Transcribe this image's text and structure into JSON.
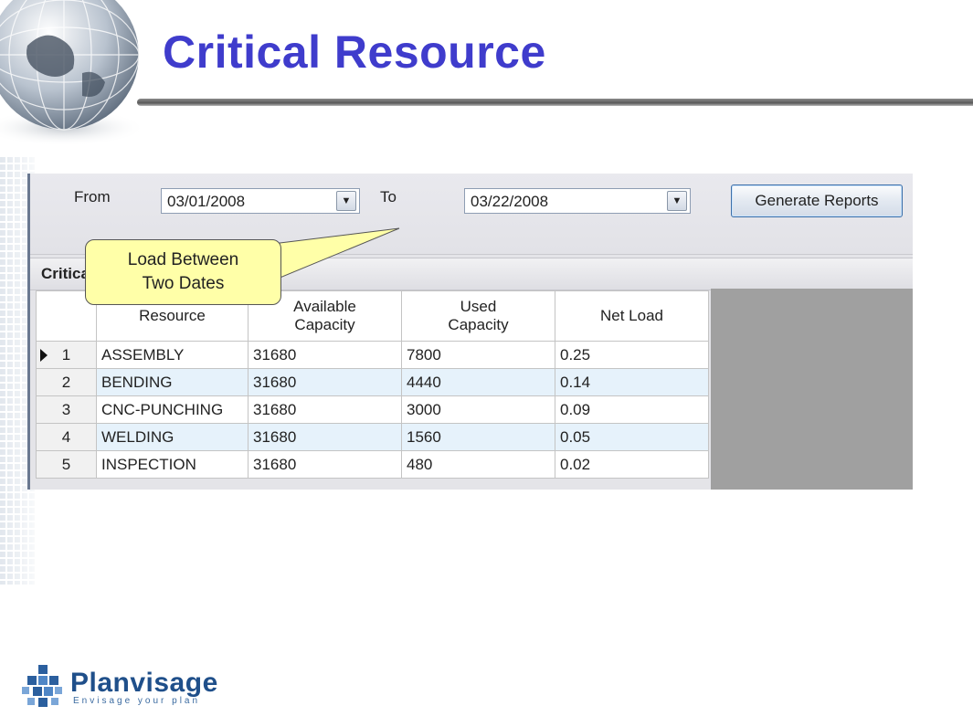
{
  "slide": {
    "title": "Critical Resource"
  },
  "app": {
    "from_label": "From",
    "from_value": "03/01/2008",
    "to_label": "To",
    "to_value": "03/22/2008",
    "generate_button": "Generate Reports",
    "section_label": "Critica",
    "grid": {
      "columns": [
        "Resource",
        "Available\nCapacity",
        "Used\nCapacity",
        "Net Load"
      ],
      "rows": [
        {
          "num": "1",
          "resource": "ASSEMBLY",
          "available": "31680",
          "used": "7800",
          "net_load": "0.25"
        },
        {
          "num": "2",
          "resource": "BENDING",
          "available": "31680",
          "used": "4440",
          "net_load": "0.14"
        },
        {
          "num": "3",
          "resource": "CNC-PUNCHING",
          "available": "31680",
          "used": "3000",
          "net_load": "0.09"
        },
        {
          "num": "4",
          "resource": "WELDING",
          "available": "31680",
          "used": "1560",
          "net_load": "0.05"
        },
        {
          "num": "5",
          "resource": "INSPECTION",
          "available": "31680",
          "used": "480",
          "net_load": "0.02"
        }
      ]
    }
  },
  "callout": {
    "line1": "Load Between",
    "line2": "Two Dates"
  },
  "logo": {
    "name": "Planvisage",
    "tagline": "Envisage your plan"
  },
  "colors": {
    "title": "#3f3ccc",
    "callout_fill": "#ffffa8",
    "grid_alt_row": "#e6f2fb",
    "logo": "#1f4f8a"
  }
}
